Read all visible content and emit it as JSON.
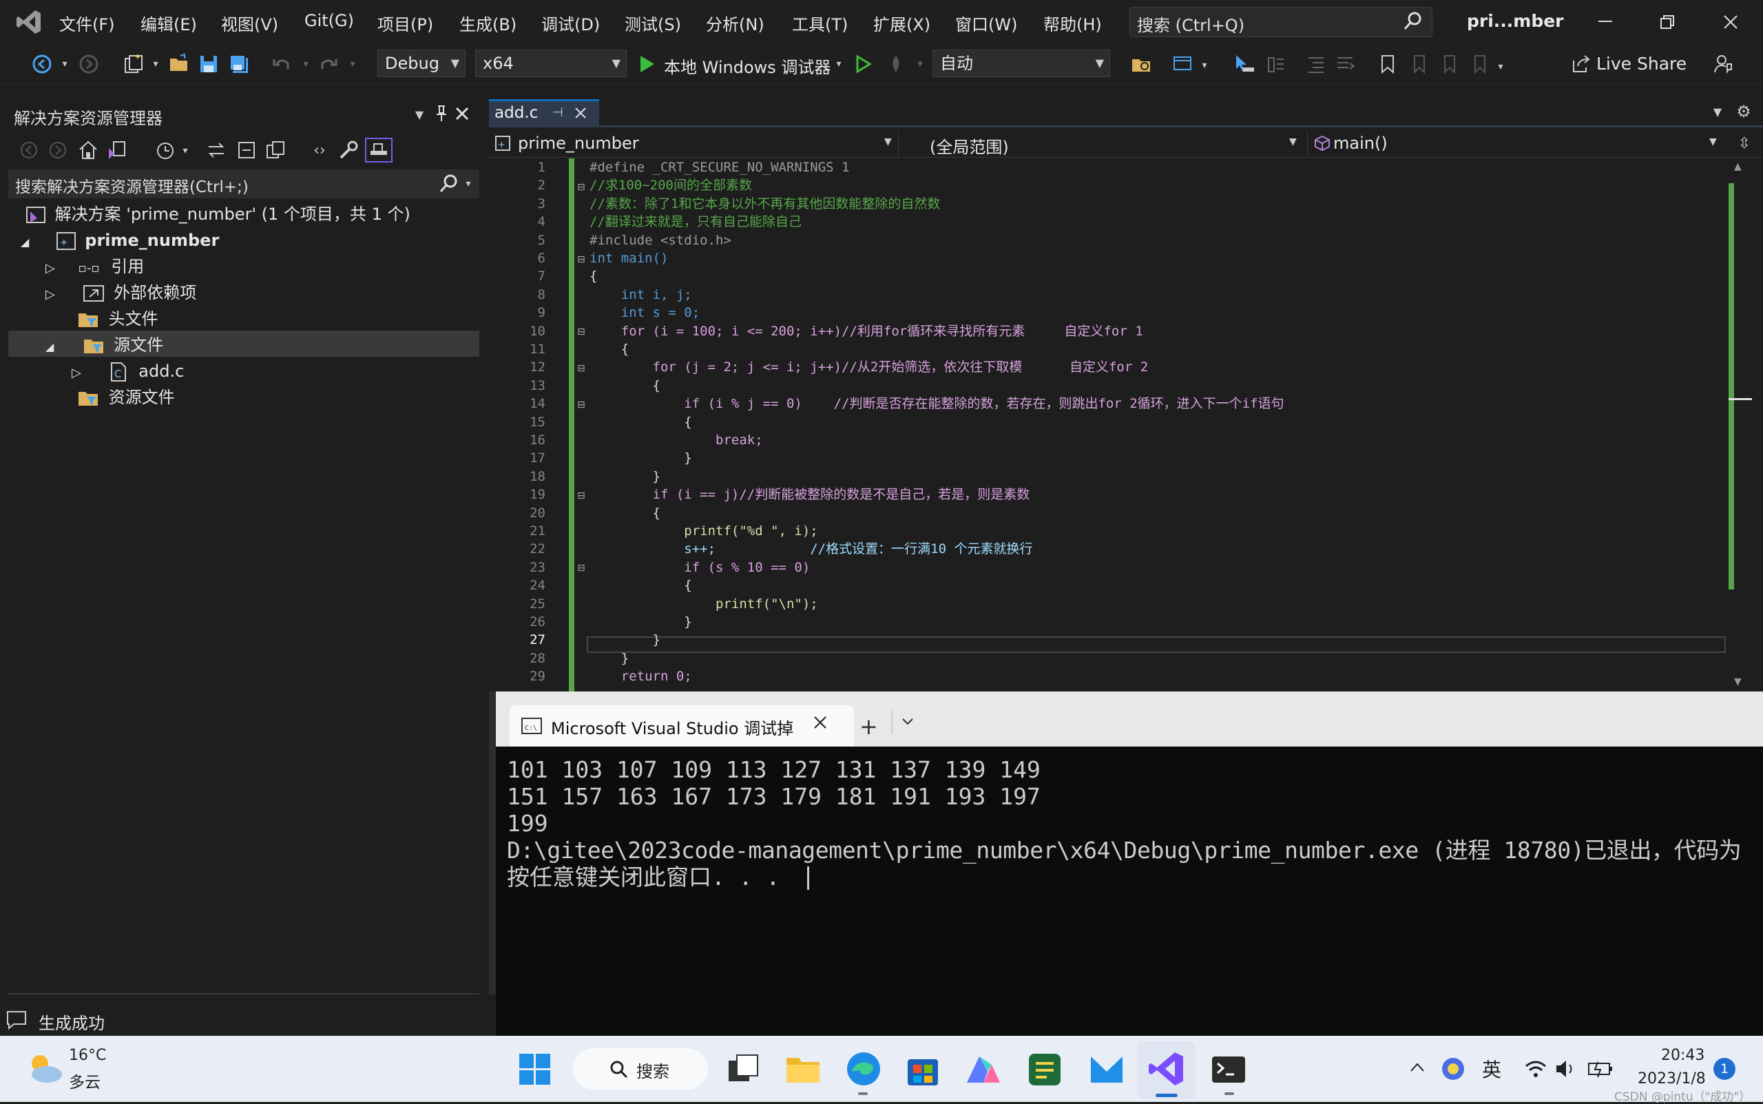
{
  "menu": {
    "items": [
      "文件(F)",
      "编辑(E)",
      "视图(V)",
      "Git(G)",
      "项目(P)",
      "生成(B)",
      "调试(D)",
      "测试(S)",
      "分析(N)",
      "工具(T)",
      "扩展(X)",
      "窗口(W)",
      "帮助(H)"
    ],
    "search_placeholder": "搜索 (Ctrl+Q)",
    "window_title": "pri...mber"
  },
  "toolbar": {
    "config": "Debug",
    "platform": "x64",
    "debugger_label": "本地 Windows 调试器",
    "auto_label": "自动",
    "live_share": "Live Share"
  },
  "solution_explorer": {
    "title": "解决方案资源管理器",
    "search_placeholder": "搜索解决方案资源管理器(Ctrl+;)",
    "solution": "解决方案 'prime_number' (1 个项目，共 1 个)",
    "project": "prime_number",
    "items": [
      "引用",
      "外部依赖项",
      "头文件",
      "源文件",
      "add.c",
      "资源文件"
    ]
  },
  "editor": {
    "tab": "add.c",
    "scope_project": "prime_number",
    "scope_global": "(全局范围)",
    "scope_func": "main()",
    "line_numbers": [
      "1",
      "2",
      "3",
      "4",
      "5",
      "6",
      "7",
      "8",
      "9",
      "10",
      "11",
      "12",
      "13",
      "14",
      "15",
      "16",
      "17",
      "18",
      "19",
      "20",
      "21",
      "22",
      "23",
      "24",
      "25",
      "26",
      "27",
      "28",
      "29"
    ],
    "lines": [
      "#define _CRT_SECURE_NO_WARNINGS 1",
      "//求100~200间的全部素数",
      "//素数：除了1和它本身以外不再有其他因数能整除的自然数",
      "//翻译过来就是，只有自己能除自己",
      "#include <stdio.h>",
      "int main()",
      "{",
      "    int i, j;",
      "    int s = 0;",
      "    for (i = 100; i <= 200; i++)//利用for循环来寻找所有元素     自定义for 1",
      "    {",
      "        for (j = 2; j <= i; j++)//从2开始筛选，依次往下取模      自定义for 2",
      "        {",
      "            if (i % j == 0)    //判断是否存在能整除的数，若存在，则跳出for 2循环，进入下一个if语句",
      "            {",
      "                break;",
      "            }",
      "        }",
      "        if (i == j)//判断能被整除的数是不是自己，若是，则是素数",
      "        {",
      "            printf(\"%d \", i);",
      "            s++;            //格式设置：一行满10 个元素就换行",
      "            if (s % 10 == 0)",
      "            {",
      "                printf(\"\\n\");",
      "            }",
      "        }",
      "    }",
      "    return 0;"
    ]
  },
  "console": {
    "tab_title": "Microsoft Visual Studio 调试掉",
    "lines": [
      "101 103 107 109 113 127 131 137 139 149",
      "151 157 163 167 173 179 181 191 193 197",
      "199",
      "D:\\gitee\\2023code-management\\prime_number\\x64\\Debug\\prime_number.exe (进程 18780)已退出，代码为",
      "按任意键关闭此窗口. . ."
    ]
  },
  "status": {
    "text": "生成成功"
  },
  "taskbar": {
    "weather_temp": "16°C",
    "weather_desc": "多云",
    "search": "搜索",
    "ime": "英",
    "time": "20:43",
    "date": "2023/1/8",
    "notif_count": "1",
    "watermark": "CSDN @pintu（\"成功\"）"
  },
  "colors": {
    "accent": "#007acc",
    "change_bar": "#57a64a",
    "vs_purple": "#7c4dff"
  }
}
